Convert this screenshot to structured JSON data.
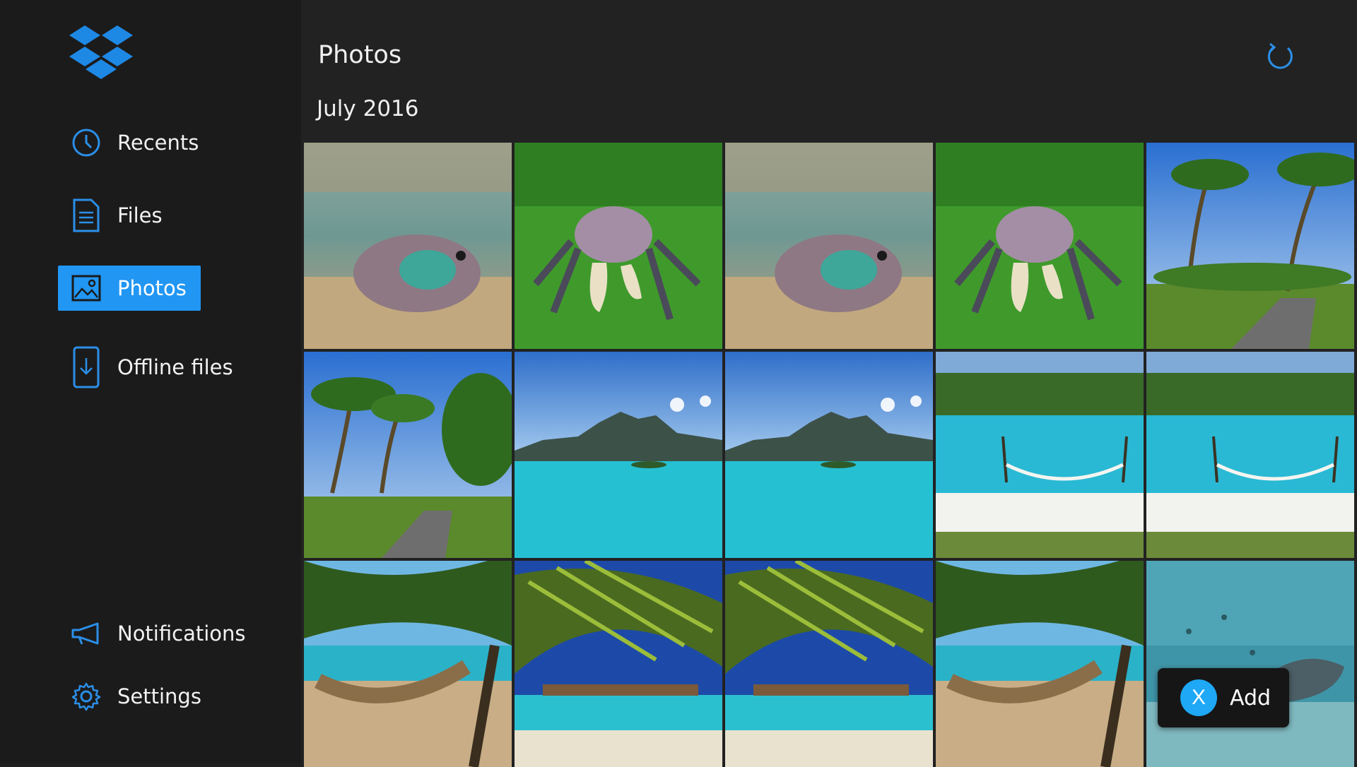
{
  "app": {
    "logo_icon": "dropbox-logo",
    "accent_color": "#2196f3"
  },
  "sidebar": {
    "items": [
      {
        "label": "Recents",
        "icon": "clock-icon"
      },
      {
        "label": "Files",
        "icon": "document-icon"
      },
      {
        "label": "Photos",
        "icon": "photo-icon",
        "active": true
      },
      {
        "label": "Offline files",
        "icon": "offline-download-icon"
      }
    ],
    "bottom_items": [
      {
        "label": "Notifications",
        "icon": "megaphone-icon"
      },
      {
        "label": "Settings",
        "icon": "gear-icon"
      }
    ]
  },
  "main": {
    "title": "Photos",
    "refresh_icon": "refresh-icon",
    "section": "July 2016",
    "photos": [
      "underwater-fish",
      "crab-on-grass",
      "underwater-fish",
      "crab-on-grass",
      "palm-road",
      "palm-road",
      "lagoon-island",
      "lagoon-island",
      "beach-hammock-lagoon",
      "beach-hammock-lagoon",
      "hammock-palms",
      "palm-fronds-bungalows",
      "palm-fronds-bungalows",
      "hammock-palms",
      "stingray-shallows"
    ]
  },
  "add_button": {
    "gamepad_key": "X",
    "label": "Add"
  }
}
